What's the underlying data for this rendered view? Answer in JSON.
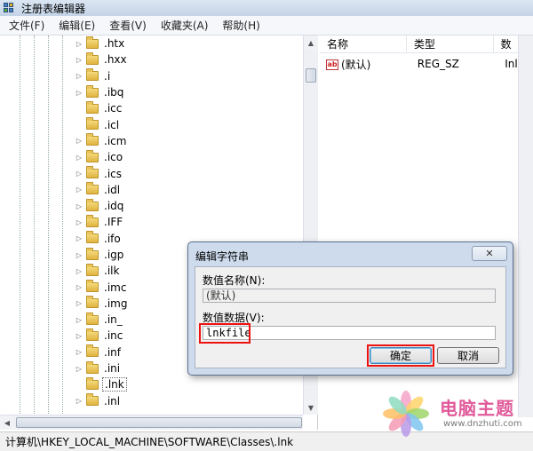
{
  "window": {
    "title": "注册表编辑器"
  },
  "menu": [
    "文件(F)",
    "编辑(E)",
    "查看(V)",
    "收藏夹(A)",
    "帮助(H)"
  ],
  "tree": {
    "items": [
      {
        "label": ".htx",
        "expandable": true
      },
      {
        "label": ".hxx",
        "expandable": true
      },
      {
        "label": ".i",
        "expandable": true
      },
      {
        "label": ".ibq",
        "expandable": true
      },
      {
        "label": ".icc",
        "expandable": false
      },
      {
        "label": ".icl",
        "expandable": false
      },
      {
        "label": ".icm",
        "expandable": true
      },
      {
        "label": ".ico",
        "expandable": true
      },
      {
        "label": ".ics",
        "expandable": true
      },
      {
        "label": ".idl",
        "expandable": true
      },
      {
        "label": ".idq",
        "expandable": true
      },
      {
        "label": ".IFF",
        "expandable": true
      },
      {
        "label": ".ifo",
        "expandable": true
      },
      {
        "label": ".igp",
        "expandable": true
      },
      {
        "label": ".ilk",
        "expandable": true
      },
      {
        "label": ".imc",
        "expandable": true
      },
      {
        "label": ".img",
        "expandable": true
      },
      {
        "label": ".in_",
        "expandable": true
      },
      {
        "label": ".inc",
        "expandable": true
      },
      {
        "label": ".inf",
        "expandable": true
      },
      {
        "label": ".ini",
        "expandable": true
      },
      {
        "label": ".lnk",
        "expandable": false,
        "selected": true
      },
      {
        "label": ".inl",
        "expandable": true
      }
    ]
  },
  "list": {
    "columns": [
      "名称",
      "类型",
      "数"
    ],
    "rows": [
      {
        "name": "(默认)",
        "type": "REG_SZ",
        "data": "Inl",
        "icon": "ab"
      }
    ]
  },
  "dialog": {
    "title": "编辑字符串",
    "close_label": "✕",
    "name_label": "数值名称(N):",
    "name_value": "(默认)",
    "data_label": "数值数据(V):",
    "data_value": "lnkfile",
    "ok_label": "确定",
    "cancel_label": "取消"
  },
  "statusbar": {
    "path": "计算机\\HKEY_LOCAL_MACHINE\\SOFTWARE\\Classes\\.lnk"
  },
  "watermark": {
    "title": "电脑主题",
    "url": "www.dnzhuti.com"
  },
  "colors": {
    "highlight": "#ee1111",
    "title_bar": "#c4d3e6",
    "dialog_frame": "#cddbec",
    "folder": "#e0b440",
    "watermark": "#e05a9a"
  }
}
